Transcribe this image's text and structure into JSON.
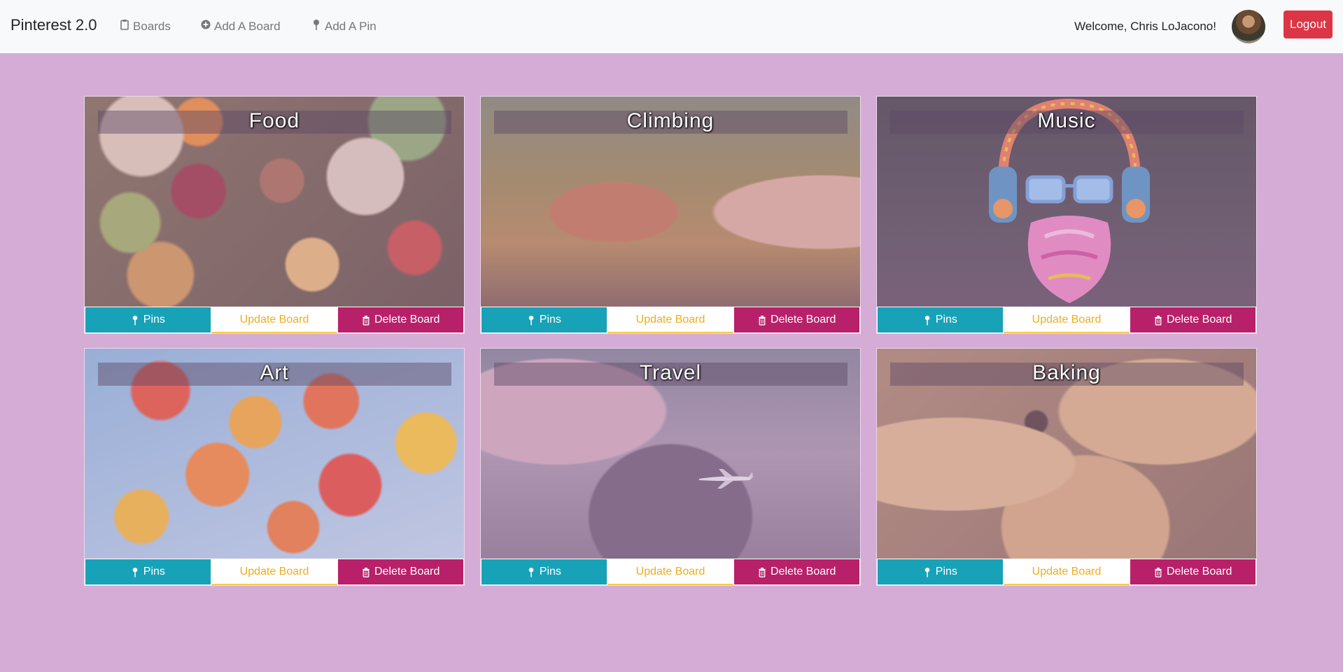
{
  "navbar": {
    "brand": "Pinterest 2.0",
    "links": [
      {
        "label": "Boards",
        "icon": "clipboard-icon"
      },
      {
        "label": "Add A Board",
        "icon": "plus-circle-icon"
      },
      {
        "label": "Add A Pin",
        "icon": "pin-icon"
      }
    ],
    "welcome": "Welcome, Chris LoJacono!",
    "logout_label": "Logout"
  },
  "colors": {
    "page_background": "#d4acd6",
    "pins_button": "#17a2b8",
    "update_button_text": "#f0ad17",
    "delete_button": "#b8206a",
    "logout_button": "#dc3545"
  },
  "boards": [
    {
      "title": "Food",
      "pins_label": "Pins",
      "update_label": "Update Board",
      "delete_label": "Delete Board"
    },
    {
      "title": "Climbing",
      "pins_label": "Pins",
      "update_label": "Update Board",
      "delete_label": "Delete Board"
    },
    {
      "title": "Music",
      "pins_label": "Pins",
      "update_label": "Update Board",
      "delete_label": "Delete Board"
    },
    {
      "title": "Art",
      "pins_label": "Pins",
      "update_label": "Update Board",
      "delete_label": "Delete Board"
    },
    {
      "title": "Travel",
      "pins_label": "Pins",
      "update_label": "Update Board",
      "delete_label": "Delete Board"
    },
    {
      "title": "Baking",
      "pins_label": "Pins",
      "update_label": "Update Board",
      "delete_label": "Delete Board"
    }
  ]
}
